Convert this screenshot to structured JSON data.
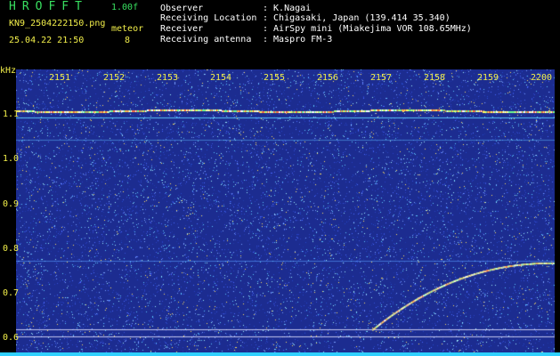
{
  "header": {
    "app_title": "HROFFT",
    "version": "1.00f",
    "filename": "KN9_2504222150.png",
    "datetime": "25.04.22 21:50",
    "meteor_label": "meteor",
    "meteor_count": "8",
    "info": [
      {
        "label": "Observer",
        "value": ": K.Nagai"
      },
      {
        "label": "Receiving Location",
        "value": ": Chigasaki, Japan (139.414 35.340)"
      },
      {
        "label": "Receiver",
        "value": ": AirSpy mini (Miakejima VOR 108.65MHz)"
      },
      {
        "label": "Receiving antenna",
        "value": ": Maspro FM-3"
      }
    ]
  },
  "axis": {
    "y_unit": "kHz",
    "y_ticks": [
      "1.1",
      "1.0",
      "0.9",
      "0.8",
      "0.7",
      "0.6"
    ],
    "x_ticks": [
      "2151",
      "2152",
      "2153",
      "2154",
      "2155",
      "2156",
      "2157",
      "2158",
      "2159",
      "2200"
    ]
  },
  "colors": {
    "background": "#000000",
    "plot_bg": "#1a2a8a",
    "label_green": "#38e060",
    "label_yellow": "#f2ef4a",
    "baseline": "#30d0ff"
  }
}
